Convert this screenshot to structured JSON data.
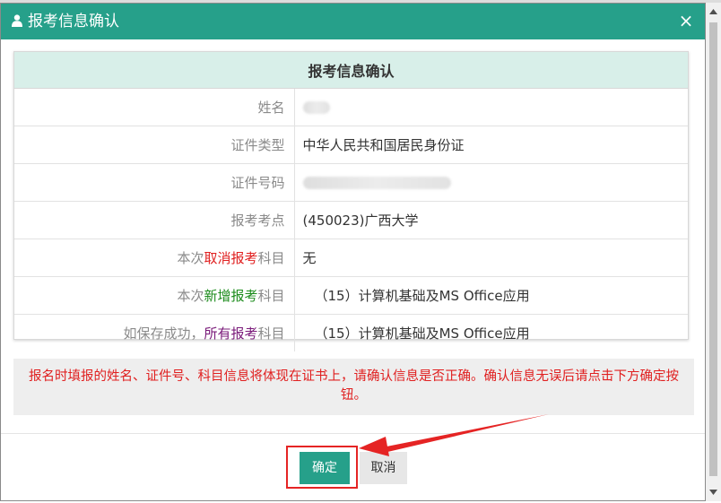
{
  "dialog": {
    "title": "报考信息确认",
    "close_label": "×",
    "user_icon": "user-icon"
  },
  "table": {
    "header": "报考信息确认",
    "rows": [
      {
        "label": "姓名",
        "value": "",
        "value_hidden": true
      },
      {
        "label": "证件类型",
        "value": "中华人民共和国居民身份证"
      },
      {
        "label": "证件号码",
        "value": "",
        "value_hidden": true
      },
      {
        "label": "报考考点",
        "value": "(450023)广西大学"
      },
      {
        "label_pre": "本次",
        "label_mid": "取消报考",
        "label_post": "科目",
        "value": "无"
      },
      {
        "label_pre": "本次",
        "label_mid": "新增报考",
        "label_post": "科目",
        "value": "（15）计算机基础及MS Office应用"
      },
      {
        "label_pre": "如保存成功，",
        "label_mid": "所有报考",
        "label_post": "科目",
        "value": "（15）计算机基础及MS Office应用"
      }
    ]
  },
  "notice": "报名时填报的姓名、证件号、科目信息将体现在证书上，请确认信息是否正确。确认信息无误后请点击下方确定按钮。",
  "buttons": {
    "confirm": "确定",
    "cancel": "取消"
  },
  "colors": {
    "accent": "#26a08a",
    "header_bg": "#d8efe9",
    "warning": "#e02020",
    "added": "#1d8c1d",
    "all": "#7a1b7a"
  }
}
